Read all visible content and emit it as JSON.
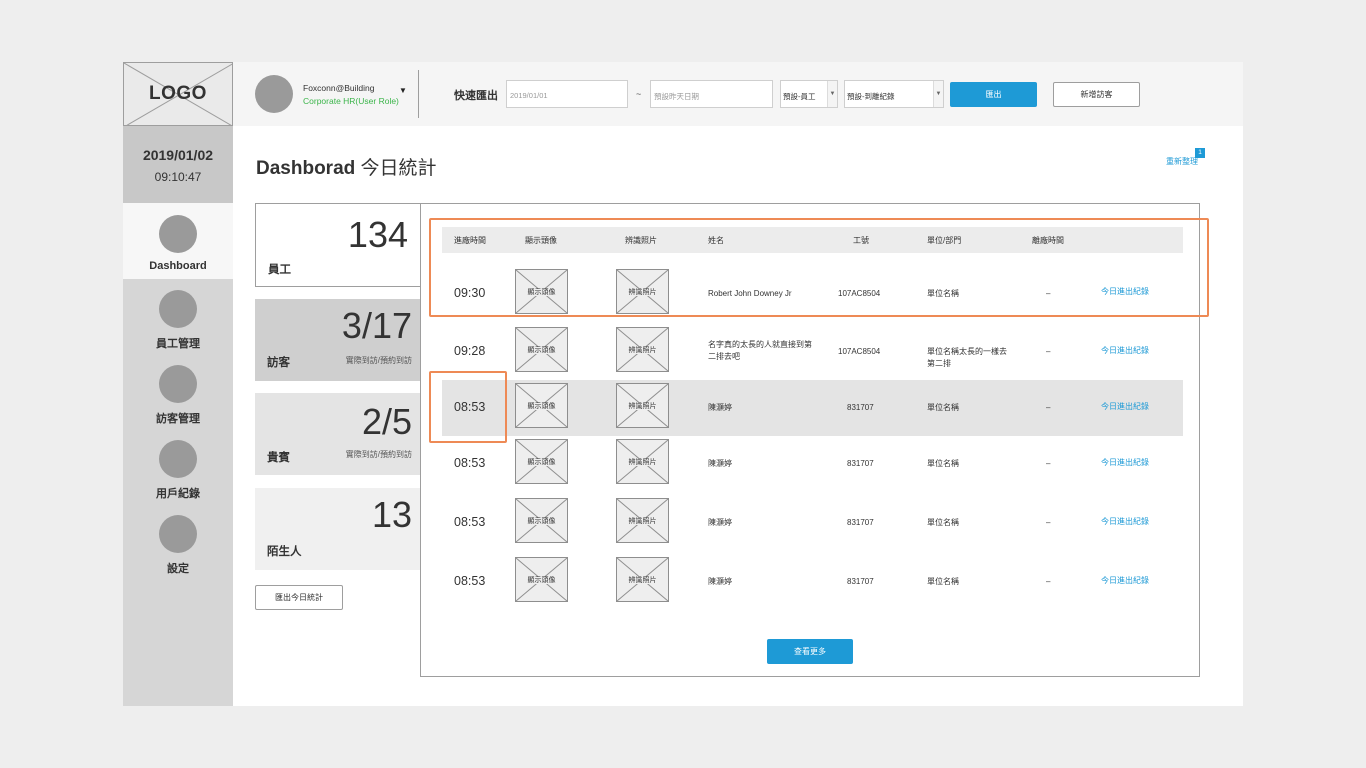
{
  "logo": {
    "text": "LOGO"
  },
  "user": {
    "name": "Foxconn@Building",
    "role": "Corporate HR(User Role)"
  },
  "quick_export": {
    "label": "快速匯出",
    "date_start": "2019/01/01",
    "date_separator": "~",
    "date_end_placeholder": "預設昨天日期",
    "employee_select": "預設-員工",
    "record_select": "預設-到離紀錄",
    "export_button": "匯出",
    "add_visitor_button": "新增訪客"
  },
  "sidebar": {
    "date": "2019/01/02",
    "time": "09:10:47",
    "items": [
      {
        "label": "Dashboard",
        "active": true
      },
      {
        "label": "員工管理"
      },
      {
        "label": "訪客管理"
      },
      {
        "label": "用戶紀錄"
      },
      {
        "label": "設定"
      }
    ]
  },
  "page": {
    "title_en": "Dashborad",
    "title_zh": "今日統計",
    "refresh_label": "重新整理",
    "refresh_badge": "1"
  },
  "stats": {
    "employees": {
      "value": "134",
      "label": "員工"
    },
    "visitors": {
      "value": "3/17",
      "label": "訪客",
      "sub": "實際到訪/預約到訪"
    },
    "vip": {
      "value": "2/5",
      "label": "貴賓",
      "sub": "實際到訪/預約到訪"
    },
    "strangers": {
      "value": "13",
      "label": "陌生人"
    },
    "export_button": "匯出今日統計"
  },
  "table": {
    "headers": [
      "進廠時間",
      "顯示頭像",
      "辨識照片",
      "姓名",
      "工號",
      "單位/部門",
      "離廠時間"
    ],
    "avatar_placeholder": "顯示頭像",
    "photo_placeholder": "辨識照片",
    "rows": [
      {
        "time": "09:30",
        "name": "Robert John Downey Jr",
        "id": "107AC8504",
        "dept": "單位名稱",
        "leave": "–",
        "link": "今日進出紀錄"
      },
      {
        "time": "09:28",
        "name": "名字真的太長的人就直接到第二排去吧",
        "id": "107AC8504",
        "dept": "單位名稱太長的一樣去第二排",
        "leave": "–",
        "link": "今日進出紀錄"
      },
      {
        "time": "08:53",
        "name": "陳灝婷",
        "id": "831707",
        "dept": "單位名稱",
        "leave": "–",
        "link": "今日進出紀錄"
      },
      {
        "time": "08:53",
        "name": "陳灝婷",
        "id": "831707",
        "dept": "單位名稱",
        "leave": "–",
        "link": "今日進出紀錄"
      },
      {
        "time": "08:53",
        "name": "陳灝婷",
        "id": "831707",
        "dept": "單位名稱",
        "leave": "–",
        "link": "今日進出紀錄"
      },
      {
        "time": "08:53",
        "name": "陳灝婷",
        "id": "831707",
        "dept": "單位名稱",
        "leave": "–",
        "link": "今日進出紀錄"
      }
    ],
    "more_button": "查看更多"
  },
  "colors": {
    "accent": "#1e9ad6",
    "role_green": "#3bb54a",
    "highlight": "#ee8a55"
  }
}
